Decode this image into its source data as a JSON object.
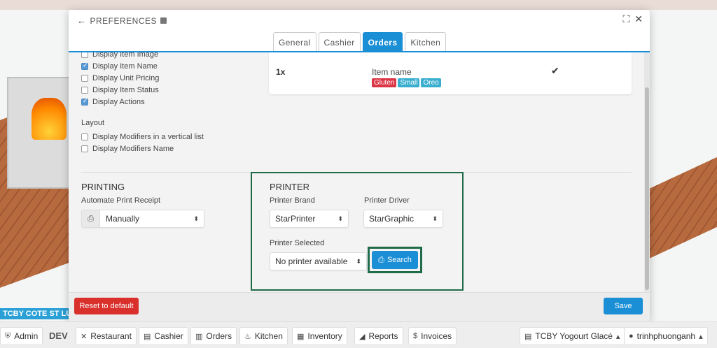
{
  "background": {
    "store_bar": "TCBY COTE ST LUC"
  },
  "modal": {
    "title": "PREFERENCES",
    "tabs": [
      {
        "label": "General",
        "active": false
      },
      {
        "label": "Cashier",
        "active": false
      },
      {
        "label": "Orders",
        "active": true
      },
      {
        "label": "Kitchen",
        "active": false
      }
    ],
    "display_options": [
      {
        "label": "Display Item Image",
        "checked": false
      },
      {
        "label": "Display Item Name",
        "checked": true
      },
      {
        "label": "Display Unit Pricing",
        "checked": false
      },
      {
        "label": "Display Item Status",
        "checked": false
      },
      {
        "label": "Display Actions",
        "checked": true
      }
    ],
    "layout": {
      "title": "Layout",
      "options": [
        {
          "label": "Display Modifiers in a vertical list",
          "checked": false
        },
        {
          "label": "Display Modifiers Name",
          "checked": false
        }
      ]
    },
    "order_preview": {
      "qty": "1x",
      "item_name": "Item name",
      "modifiers": [
        {
          "label": "Gluten",
          "color": "#dc3545"
        },
        {
          "label": "Small",
          "color": "#3aaecf"
        },
        {
          "label": "Oreo",
          "color": "#3aaecf"
        }
      ],
      "check": "✔"
    },
    "printing": {
      "title": "PRINTING",
      "auto_print_label": "Automate Print Receipt",
      "auto_print_value": "Manually"
    },
    "printer": {
      "title": "PRINTER",
      "brand_label": "Printer Brand",
      "brand_value": "StarPrinter",
      "driver_label": "Printer Driver",
      "driver_value": "StarGraphic",
      "selected_label": "Printer Selected",
      "selected_value": "No printer available",
      "search_label": "Search"
    },
    "footer": {
      "reset_label": "Reset to default",
      "save_label": "Save"
    }
  },
  "bottom_nav": {
    "admin": "Admin",
    "env": "DEV",
    "restaurant": "Restaurant",
    "cashier": "Cashier",
    "orders": "Orders",
    "kitchen": "Kitchen",
    "inventory": "Inventory",
    "reports": "Reports",
    "invoices": "Invoices",
    "store": "TCBY Yogourt Glacé",
    "user": "trinhphuonganh"
  }
}
